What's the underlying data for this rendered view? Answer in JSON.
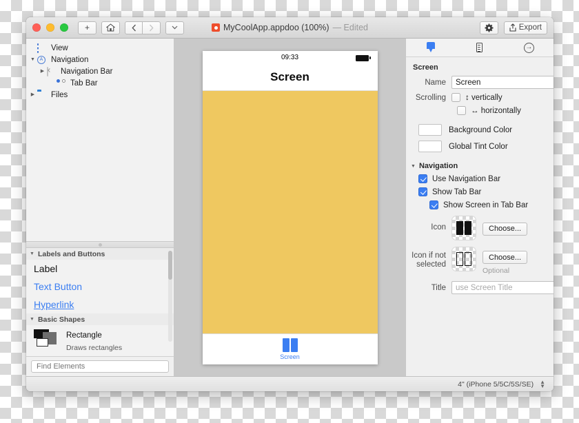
{
  "window": {
    "title": "MyCoolApp.appdoo (100%)",
    "title_suffix": "— Edited",
    "doc_icon": "document-icon"
  },
  "toolbar": {
    "add_label": "+",
    "home_icon": "home-icon",
    "back_icon": "chevron-left-icon",
    "forward_icon": "chevron-right-icon",
    "dropdown_icon": "chevron-down-icon",
    "settings_icon": "gear-icon",
    "export_label": "Export",
    "export_icon": "share-icon"
  },
  "tree": {
    "items": [
      {
        "label": "View",
        "icon": "view-icon",
        "twisty": "none",
        "indent": 1
      },
      {
        "label": "Navigation",
        "icon": "navigation-icon",
        "twisty": "open",
        "indent": 1
      },
      {
        "label": "Navigation Bar",
        "icon": "navigation-bar-icon",
        "twisty": "closed",
        "indent": 2
      },
      {
        "label": "Tab Bar",
        "icon": "tab-bar-icon",
        "twisty": "none",
        "indent": 3
      },
      {
        "label": "Files",
        "icon": "folder-icon",
        "twisty": "closed",
        "indent": 1
      }
    ]
  },
  "library": {
    "groups": [
      {
        "title": "Labels and Buttons",
        "items": [
          {
            "label": "Label",
            "style": "plain"
          },
          {
            "label": "Text Button",
            "style": "accent"
          },
          {
            "label": "Hyperlink",
            "style": "link"
          }
        ]
      },
      {
        "title": "Basic Shapes",
        "items": [
          {
            "label": "Rectangle",
            "subtitle": "Draws rectangles",
            "style": "shape"
          }
        ]
      }
    ],
    "search_placeholder": "Find Elements"
  },
  "preview": {
    "status_time": "09:33",
    "battery_icon": "battery-full-icon",
    "nav_title": "Screen",
    "background_color": "#efc860",
    "tab": {
      "icon": "book-icon",
      "label": "Screen",
      "tint_color": "#3b7ef2"
    }
  },
  "inspector": {
    "tabs": [
      {
        "name": "attributes",
        "icon": "pin-icon",
        "active": true
      },
      {
        "name": "size",
        "icon": "ruler-icon",
        "active": false
      },
      {
        "name": "connections",
        "icon": "arrow-circle-right-icon",
        "active": false
      }
    ],
    "screen_section": {
      "title": "Screen",
      "name_label": "Name",
      "name_value": "Screen",
      "scrolling_label": "Scrolling",
      "scroll_vertical_label": "vertically",
      "scroll_vertical_icon": "arrows-vertical-icon",
      "scroll_vertical_checked": false,
      "scroll_horizontal_label": "horizontally",
      "scroll_horizontal_icon": "arrows-horizontal-icon",
      "scroll_horizontal_checked": false,
      "background_color_label": "Background Color",
      "background_color": "#e8c15f",
      "global_tint_label": "Global Tint Color",
      "global_tint_color": "#3370e8"
    },
    "navigation_section": {
      "title": "Navigation",
      "use_nav_bar_label": "Use Navigation Bar",
      "use_nav_bar_checked": true,
      "show_tab_bar_label": "Show Tab Bar",
      "show_tab_bar_checked": true,
      "show_screen_in_tab_bar_label": "Show Screen in Tab Bar",
      "show_screen_in_tab_bar_checked": true,
      "icon_label": "Icon",
      "icon_choose_label": "Choose...",
      "icon_not_selected_label": "Icon if not selected",
      "icon_not_selected_choose_label": "Choose...",
      "optional_label": "Optional",
      "title_label": "Title",
      "title_placeholder": "use Screen Title",
      "title_value": ""
    }
  },
  "footer": {
    "device": "4\" (iPhone 5/5C/5S/SE)",
    "stepper_icon": "stepper-icon"
  }
}
